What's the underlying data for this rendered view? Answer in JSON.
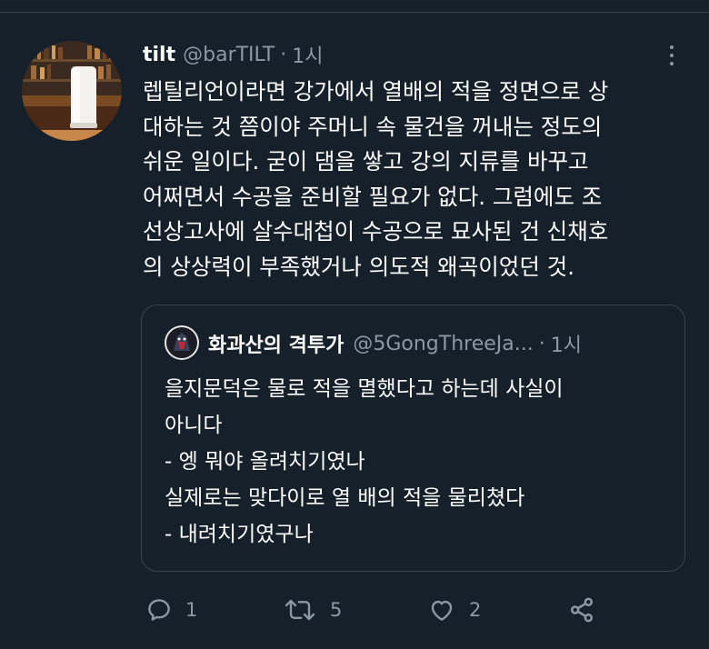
{
  "tweet": {
    "name": "tilt",
    "handle": "@barTILT",
    "separator": "·",
    "time": "1시",
    "lines": [
      "렙틸리언이라면 강가에서 열배의 적을 정면으로 상",
      "대하는 것 쯤이야 주머니 속 물건을 꺼내는 정도의",
      "쉬운 일이다. 굳이 댐을 쌓고 강의 지류를 바꾸고",
      "어쩌면서 수공을 준비할 필요가 없다. 그럼에도 조",
      "선상고사에 살수대첩이 수공으로 묘사된 건 신채호",
      "의 상상력이 부족했거나 의도적 왜곡이었던 것."
    ]
  },
  "quote": {
    "name": "화과산의 격투가",
    "handle": "@5GongThreeJa...",
    "separator": "·",
    "time": "1시",
    "lines": [
      "을지문덕은 물로 적을 멸했다고 하는데 사실이",
      "아니다",
      "- 엥 뭐야 올려치기였나",
      "실제로는 맞다이로 열 배의 적을 물리쳤다",
      "- 내려치기였구나"
    ]
  },
  "actions": {
    "reply_count": "1",
    "retweet_count": "5",
    "like_count": "2"
  },
  "icons": {
    "more": "more-vertical-icon",
    "reply": "reply-icon",
    "retweet": "retweet-icon",
    "like": "heart-icon",
    "share": "share-icon"
  },
  "colors": {
    "background": "#15202b",
    "secondary_text": "#8b98a5",
    "border": "#38444d"
  }
}
